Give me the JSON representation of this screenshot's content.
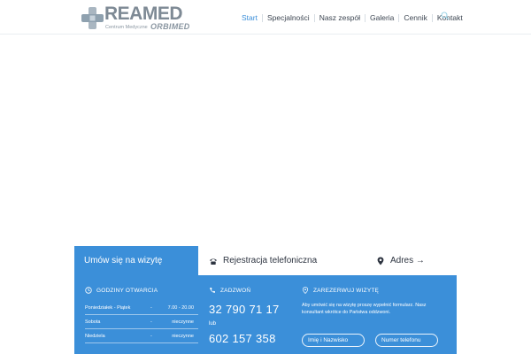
{
  "logo": {
    "word": "REAMED",
    "subtitle": "Centrum Medyczne",
    "sub_brand": "ORBIMED"
  },
  "nav": {
    "items": [
      {
        "label": "Start",
        "active": true
      },
      {
        "label": "Specjalności",
        "active": false
      },
      {
        "label": "Nasz zespół",
        "active": false
      },
      {
        "label": "Galeria",
        "active": false
      },
      {
        "label": "Cennik",
        "active": false
      },
      {
        "label": "Kontakt",
        "active": false
      }
    ],
    "search_icon": "search-icon"
  },
  "tabs": {
    "appointment": "Umów się na wizytę",
    "phone_registration": "Rejestracja telefoniczna",
    "address": "Adres →"
  },
  "hours": {
    "heading": "GODZINY OTWARCIA",
    "rows": [
      {
        "day": "Poniedziałek - Piątek",
        "dash": "-",
        "time": "7.00 - 20.00"
      },
      {
        "day": "Sobota",
        "dash": "-",
        "time": "nieczynne"
      },
      {
        "day": "Niedziela",
        "dash": "-",
        "time": "nieczynne"
      }
    ]
  },
  "call": {
    "heading": "ZADZWOŃ",
    "number1": "32 790 71 17",
    "or": "lub",
    "number2": "602 157 358"
  },
  "reserve": {
    "heading": "ZAREZERWUJ WIZYTĘ",
    "text": "Aby umówić się na wizytę proszę wypełnić formularz. Nasz konsultant wkrótce do Państwa oddzwoni.",
    "name_placeholder": "Imię i Nazwisko",
    "phone_placeholder": "Numer telefonu"
  },
  "colors": {
    "accent": "#3b8fd9",
    "nav_active": "#3b8fd9",
    "logo_grey": "#7e8a95"
  }
}
